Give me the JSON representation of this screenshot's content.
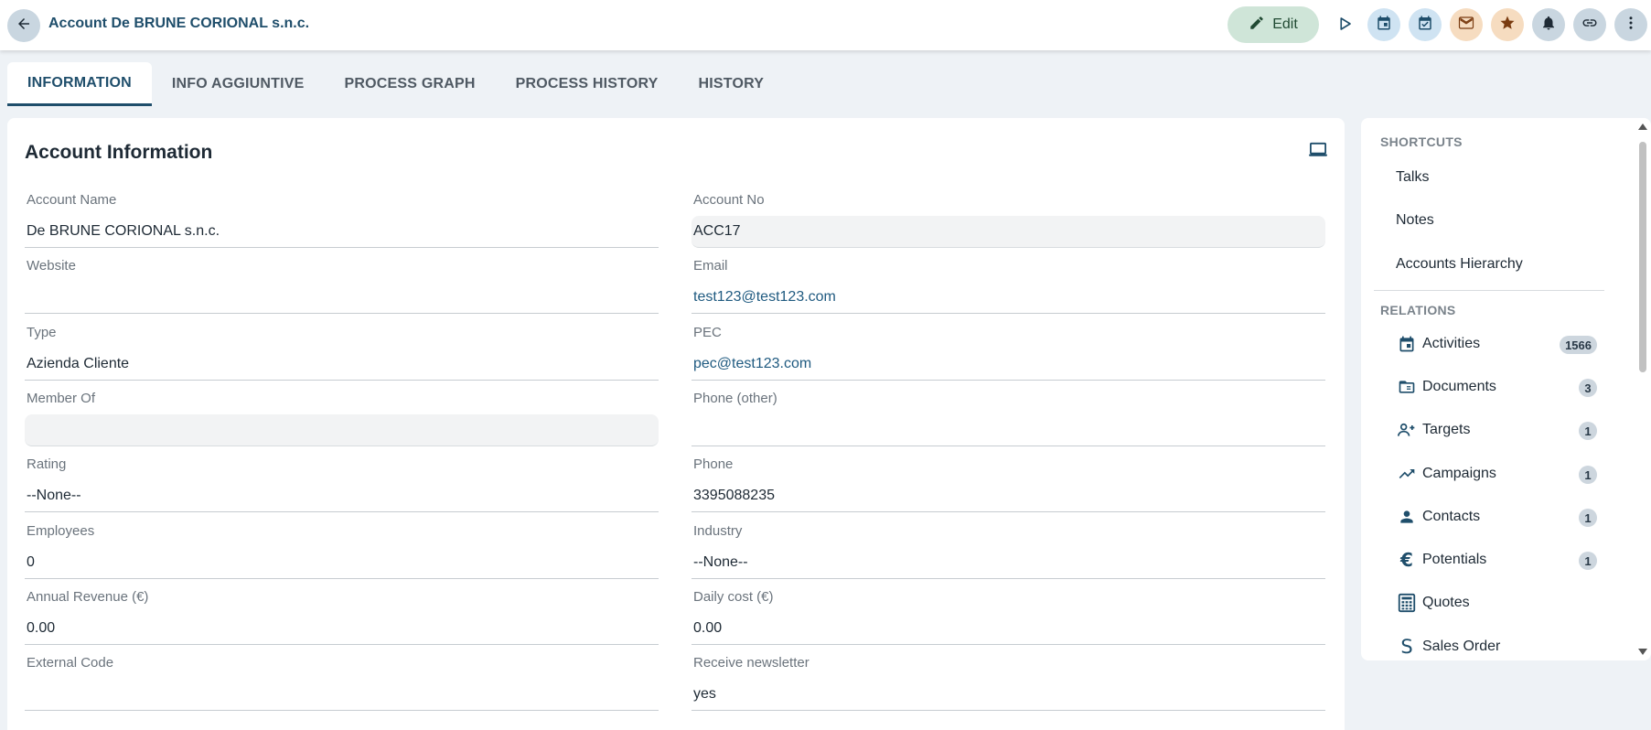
{
  "header": {
    "title": "Account De BRUNE CORIONAL s.n.c.",
    "edit_label": "Edit"
  },
  "tabs": [
    {
      "label": "INFORMATION"
    },
    {
      "label": "INFO AGGIUNTIVE"
    },
    {
      "label": "PROCESS GRAPH"
    },
    {
      "label": "PROCESS HISTORY"
    },
    {
      "label": "HISTORY"
    }
  ],
  "card": {
    "title": "Account Information",
    "left": [
      {
        "label": "Account Name",
        "value": "De BRUNE CORIONAL s.n.c."
      },
      {
        "label": "Website",
        "value": ""
      },
      {
        "label": "Type",
        "value": "Azienda Cliente"
      },
      {
        "label": "Member Of",
        "value": ""
      },
      {
        "label": "Rating",
        "value": "--None--"
      },
      {
        "label": "Employees",
        "value": "0"
      },
      {
        "label": "Annual Revenue (€)",
        "value": "0.00"
      },
      {
        "label": "External Code",
        "value": ""
      }
    ],
    "right": [
      {
        "label": "Account No",
        "value": "ACC17"
      },
      {
        "label": "Email",
        "value": "test123@test123.com"
      },
      {
        "label": "PEC",
        "value": "pec@test123.com"
      },
      {
        "label": "Phone (other)",
        "value": ""
      },
      {
        "label": "Phone",
        "value": "3395088235"
      },
      {
        "label": "Industry",
        "value": "--None--"
      },
      {
        "label": "Daily cost (€)",
        "value": "0.00"
      },
      {
        "label": "Receive newsletter",
        "value": "yes"
      }
    ]
  },
  "side": {
    "shortcuts_title": "SHORTCUTS",
    "shortcuts": [
      "Talks",
      "Notes",
      "Accounts Hierarchy"
    ],
    "relations_title": "RELATIONS",
    "relations": [
      {
        "name": "Activities",
        "count": "1566",
        "icon": "calendar-icon"
      },
      {
        "name": "Documents",
        "count": "3",
        "icon": "folder-icon"
      },
      {
        "name": "Targets",
        "count": "1",
        "icon": "group-add-icon"
      },
      {
        "name": "Campaigns",
        "count": "1",
        "icon": "trending-up-icon"
      },
      {
        "name": "Contacts",
        "count": "1",
        "icon": "person-icon"
      },
      {
        "name": "Potentials",
        "count": "1",
        "icon": "euro-icon"
      },
      {
        "name": "Quotes",
        "count": "",
        "icon": "calculator-icon"
      },
      {
        "name": "Sales Order",
        "count": "",
        "icon": "sales-order-icon"
      }
    ]
  },
  "colors": {
    "accent": "#1f4e6b",
    "edit_bg": "#cfe5d8",
    "calendar_bg": "#cfe3f2",
    "task_bg": "#cfe3f2",
    "mail_bg": "#f6dcc0",
    "star_bg": "#f6dcc0",
    "neutral_bg": "#c9d6e0"
  }
}
